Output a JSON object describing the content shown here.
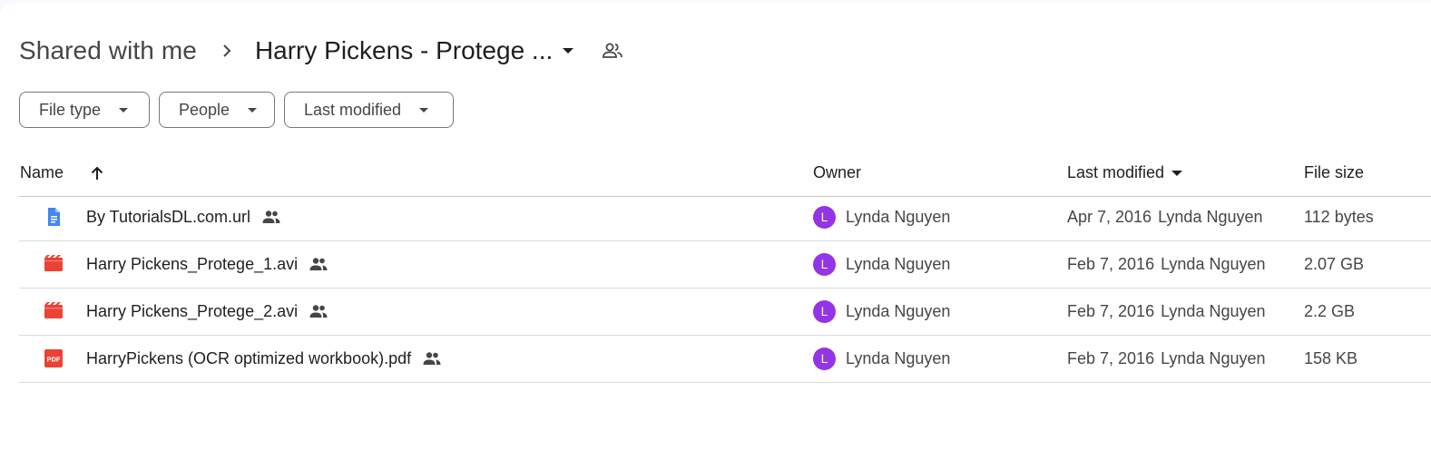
{
  "breadcrumb": {
    "root": "Shared with me",
    "current": "Harry Pickens - Protege ..."
  },
  "filters": [
    "File type",
    "People",
    "Last modified"
  ],
  "columns": {
    "name": "Name",
    "owner": "Owner",
    "modified": "Last modified",
    "size": "File size"
  },
  "files": [
    {
      "name": "By TutorialsDL.com.url",
      "icon": "document-icon",
      "owner_initial": "L",
      "owner": "Lynda Nguyen",
      "modified_date": "Apr 7, 2016",
      "modified_by": "Lynda Nguyen",
      "size": "112 bytes"
    },
    {
      "name": "Harry Pickens_Protege_1.avi",
      "icon": "video-icon",
      "owner_initial": "L",
      "owner": "Lynda Nguyen",
      "modified_date": "Feb 7, 2016",
      "modified_by": "Lynda Nguyen",
      "size": "2.07 GB"
    },
    {
      "name": "Harry Pickens_Protege_2.avi",
      "icon": "video-icon",
      "owner_initial": "L",
      "owner": "Lynda Nguyen",
      "modified_date": "Feb 7, 2016",
      "modified_by": "Lynda Nguyen",
      "size": "2.2 GB"
    },
    {
      "name": "HarryPickens (OCR optimized workbook).pdf",
      "icon": "pdf-icon",
      "owner_initial": "L",
      "owner": "Lynda Nguyen",
      "modified_date": "Feb 7, 2016",
      "modified_by": "Lynda Nguyen",
      "size": "158 KB"
    }
  ],
  "icons": {
    "pdf_label": "PDF"
  },
  "colors": {
    "doc_blue": "#4285f4",
    "video_red": "#ea4335",
    "avatar_purple": "#9334e6"
  }
}
